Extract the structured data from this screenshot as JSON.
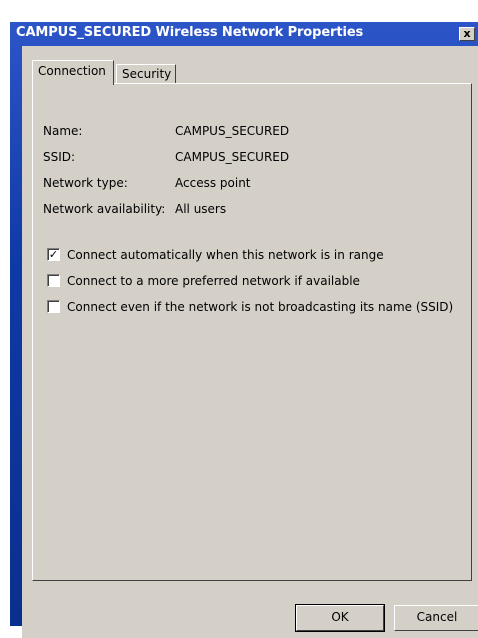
{
  "window": {
    "title": "CAMPUS_SECURED Wireless Network Properties",
    "close_glyph": "x"
  },
  "tabs": [
    {
      "label": "Connection",
      "active": true
    },
    {
      "label": "Security",
      "active": false
    }
  ],
  "properties": [
    {
      "label": "Name:",
      "value": "CAMPUS_SECURED"
    },
    {
      "label": "SSID:",
      "value": "CAMPUS_SECURED"
    },
    {
      "label": "Network type:",
      "value": "Access point"
    },
    {
      "label": "Network availability:",
      "value": "All users"
    }
  ],
  "options": [
    {
      "label": "Connect automatically when this network is in range",
      "checked": true,
      "mark": "✓"
    },
    {
      "label": "Connect to a more preferred network if available",
      "checked": false,
      "mark": ""
    },
    {
      "label": "Connect even if the network is not broadcasting its name (SSID)",
      "checked": false,
      "mark": ""
    }
  ],
  "buttons": {
    "ok": "OK",
    "cancel": "Cancel"
  },
  "colors": {
    "titlebar": "#0e3aa6",
    "dialog_face": "#d4d0c8"
  }
}
